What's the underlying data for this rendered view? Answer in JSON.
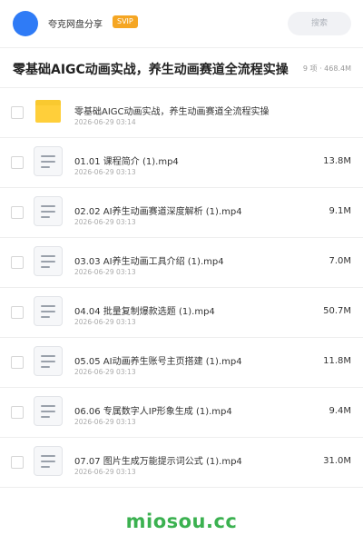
{
  "header": {
    "app_name": "夸克网盘分享",
    "badge": "SVIP",
    "search_placeholder": "搜索"
  },
  "page": {
    "title": "零基础AIGC动画实战，养生动画赛道全流程实操",
    "meta": "9 项 · 468.4M"
  },
  "files": [
    {
      "name": "零基础AIGC动画实战，养生动画赛道全流程实操",
      "date": "2026-06-29 03:14",
      "size": "",
      "type": "folder"
    },
    {
      "name": "01.01 课程简介 (1).mp4",
      "date": "2026-06-29 03:13",
      "size": "13.8M",
      "type": "video"
    },
    {
      "name": "02.02 AI养生动画赛道深度解析 (1).mp4",
      "date": "2026-06-29 03:13",
      "size": "9.1M",
      "type": "video"
    },
    {
      "name": "03.03 AI养生动画工具介绍 (1).mp4",
      "date": "2026-06-29 03:13",
      "size": "7.0M",
      "type": "video"
    },
    {
      "name": "04.04 批量复制爆款选题 (1).mp4",
      "date": "2026-06-29 03:13",
      "size": "50.7M",
      "type": "video"
    },
    {
      "name": "05.05 AI动画养生账号主页搭建 (1).mp4",
      "date": "2026-06-29 03:13",
      "size": "11.8M",
      "type": "video"
    },
    {
      "name": "06.06 专属数字人IP形象生成 (1).mp4",
      "date": "2026-06-29 03:13",
      "size": "9.4M",
      "type": "video"
    },
    {
      "name": "07.07 图片生成万能提示词公式 (1).mp4",
      "date": "2026-06-29 03:13",
      "size": "31.0M",
      "type": "video"
    }
  ],
  "footer": {
    "watermark": "miosou.cc"
  }
}
